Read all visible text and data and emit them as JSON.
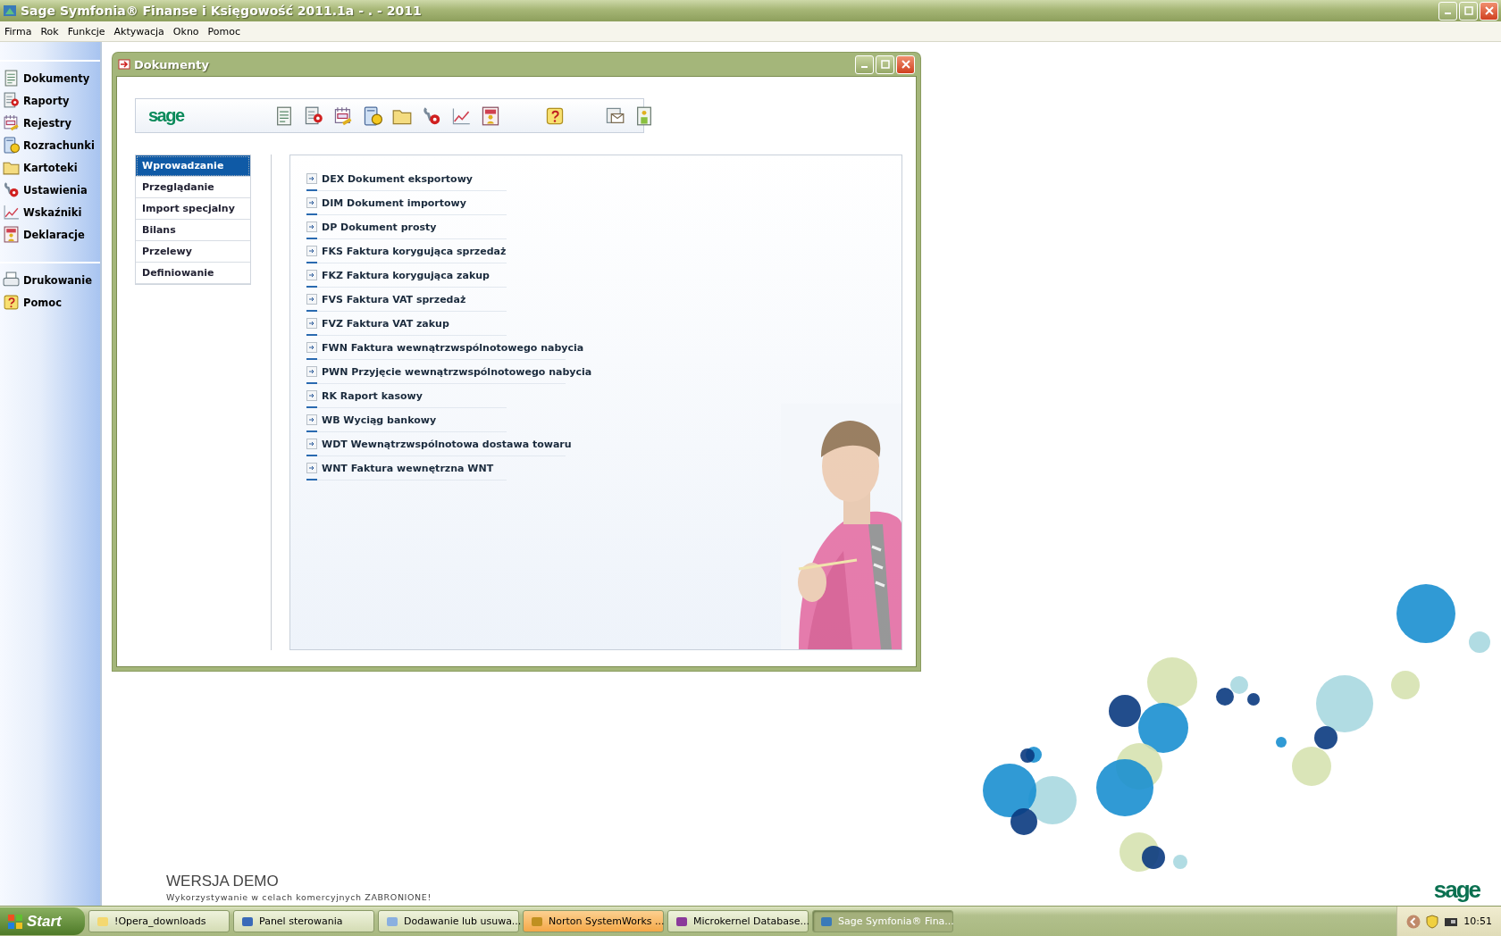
{
  "window": {
    "title": "Sage Symfonia® Finanse i Księgowość 2011.1a - . - 2011"
  },
  "menu": [
    "Firma",
    "Rok",
    "Funkcje",
    "Aktywacja",
    "Okno",
    "Pomoc"
  ],
  "sidebar": {
    "groups": [
      {
        "items": [
          {
            "label": "Dokumenty"
          },
          {
            "label": "Raporty"
          },
          {
            "label": "Rejestry"
          },
          {
            "label": "Rozrachunki"
          },
          {
            "label": "Kartoteki"
          },
          {
            "label": "Ustawienia"
          },
          {
            "label": "Wskaźniki"
          },
          {
            "label": "Deklaracje"
          }
        ]
      },
      {
        "items": [
          {
            "label": "Drukowanie"
          },
          {
            "label": "Pomoc"
          }
        ]
      }
    ]
  },
  "document_window": {
    "title": "Dokumenty",
    "logo": "sage",
    "nav": [
      {
        "label": "Wprowadzanie",
        "selected": true
      },
      {
        "label": "Przeglądanie",
        "selected": false
      },
      {
        "label": "Import specjalny",
        "selected": false
      },
      {
        "label": "Bilans",
        "selected": false
      },
      {
        "label": "Przelewy",
        "selected": false
      },
      {
        "label": "Definiowanie",
        "selected": false
      }
    ],
    "documents": [
      "DEX Dokument eksportowy",
      "DIM Dokument importowy",
      "DP Dokument prosty",
      "FKS Faktura korygująca sprzedaż",
      "FKZ Faktura korygująca zakup",
      "FVS Faktura VAT sprzedaż",
      "FVZ Faktura VAT zakup",
      "FWN Faktura wewnątrzwspólnotowego nabycia",
      "PWN Przyjęcie wewnątrzwspólnotowego nabycia",
      "RK Raport kasowy",
      "WB Wyciąg bankowy",
      "WDT Wewnątrzwspólnotowa dostawa towaru",
      "WNT Faktura wewnętrzna WNT"
    ]
  },
  "footer": {
    "edition": "WERSJA DEMO",
    "notice": "Wykorzystywanie w celach komercyjnych ZABRONIONE!",
    "logo": "sage"
  },
  "taskbar": {
    "start": "Start",
    "tasks": [
      {
        "label": "!Opera_downloads",
        "selected": false,
        "attention": false
      },
      {
        "label": "Panel sterowania",
        "selected": false,
        "attention": false
      },
      {
        "label": "Dodawanie lub usuwa...",
        "selected": false,
        "attention": false
      },
      {
        "label": "Norton SystemWorks ...",
        "selected": false,
        "attention": true
      },
      {
        "label": "Microkernel Database...",
        "selected": false,
        "attention": false
      },
      {
        "label": "Sage Symfonia® Fina...",
        "selected": true,
        "attention": false
      }
    ],
    "clock": "10:51"
  }
}
